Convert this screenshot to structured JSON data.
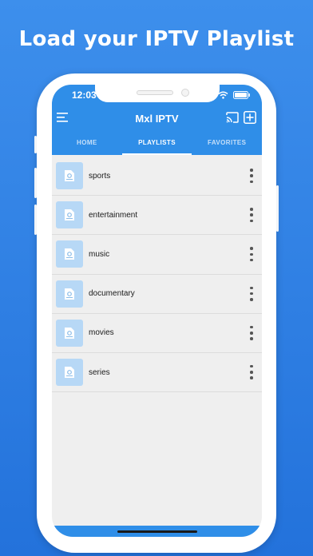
{
  "headline": "Load your IPTV Playlist",
  "status": {
    "time": "12:03"
  },
  "app": {
    "title": "Mxl IPTV",
    "brand_color": "#2f8ee8"
  },
  "icons": {
    "menu": "menu-icon",
    "cast": "cast-icon",
    "add": "add-icon",
    "wifi": "wifi-icon",
    "battery": "battery-icon",
    "playlist": "playlist-file-icon",
    "more": "more-vertical-icon"
  },
  "tabs": [
    {
      "label": "HOME",
      "active": false
    },
    {
      "label": "PLAYLISTS",
      "active": true
    },
    {
      "label": "FAVORITES",
      "active": false
    }
  ],
  "playlists": [
    {
      "label": "sports"
    },
    {
      "label": "entertainment"
    },
    {
      "label": "music"
    },
    {
      "label": "documentary"
    },
    {
      "label": "movies"
    },
    {
      "label": "series"
    }
  ]
}
